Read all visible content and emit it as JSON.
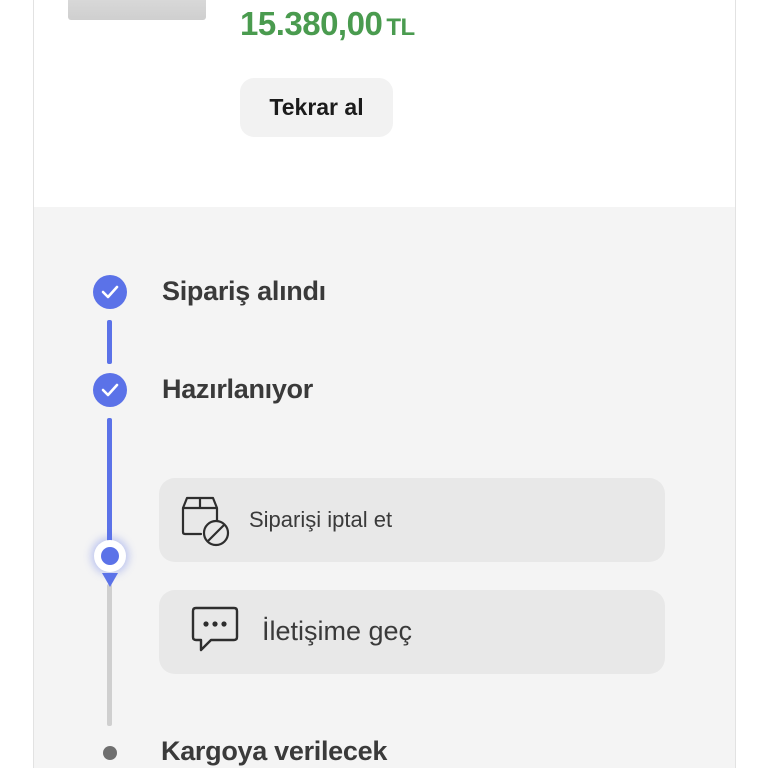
{
  "product": {
    "price_value": "15.380,00",
    "price_currency": "TL",
    "rebuy_label": "Tekrar al"
  },
  "colors": {
    "accent": "#5b72e8",
    "price": "#4a9b4f",
    "section_bg": "#f4f4f4",
    "card_bg": "#e8e8e8"
  },
  "timeline": {
    "steps": [
      {
        "label": "Sipariş alındı",
        "state": "completed",
        "icon": "check-icon"
      },
      {
        "label": "Hazırlanıyor",
        "state": "completed",
        "icon": "check-icon"
      },
      {
        "label": "Kargoya verilecek",
        "state": "pending",
        "icon": "dot-icon"
      }
    ],
    "current_marker_icon": "location-pin-icon"
  },
  "actions": {
    "cancel": {
      "label": "Siparişi iptal et",
      "icon": "package-cancel-icon"
    },
    "contact": {
      "label": "İletişime geç",
      "icon": "chat-bubble-icon"
    }
  }
}
